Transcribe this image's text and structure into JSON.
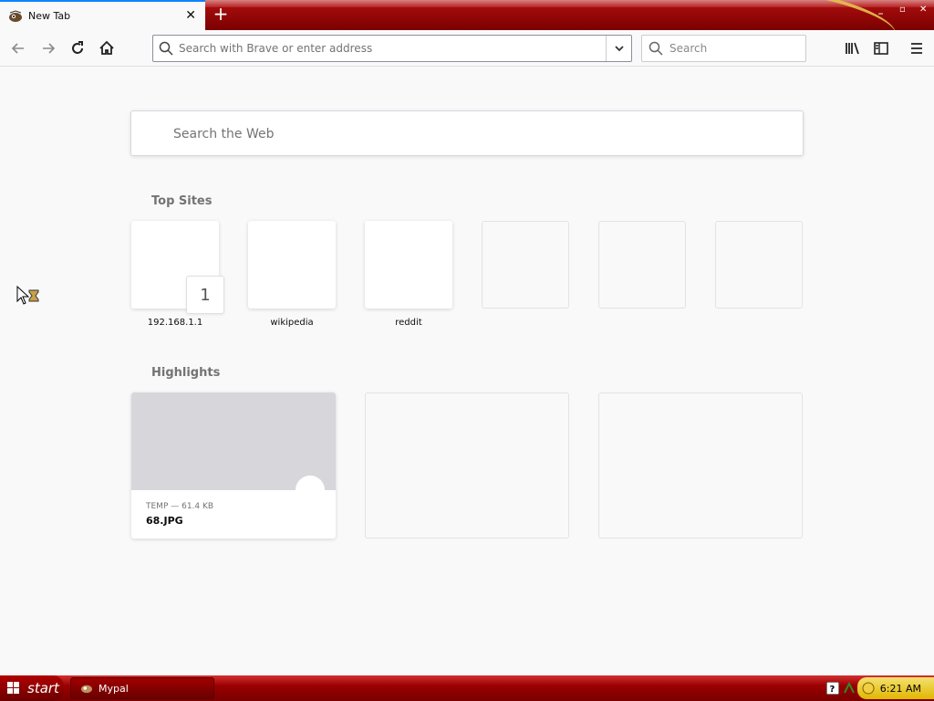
{
  "tab": {
    "title": "New Tab",
    "close_glyph": "✕"
  },
  "newtab_glyph": "+",
  "window_controls": {
    "minimize": "_",
    "restore": "▫",
    "close": "✕"
  },
  "urlbar": {
    "placeholder": "Search with Brave or enter address"
  },
  "searchbar": {
    "placeholder": "Search"
  },
  "web_search": {
    "placeholder": "Search the Web"
  },
  "top_sites": {
    "title": "Top Sites",
    "sites": [
      {
        "label": "192.168.1.1",
        "badge": "1"
      },
      {
        "label": "wikipedia"
      },
      {
        "label": "reddit"
      }
    ]
  },
  "highlights": {
    "title": "Highlights",
    "cards": [
      {
        "meta": "TEMP — 61.4 KB",
        "name": "68.JPG"
      }
    ]
  },
  "taskbar": {
    "start_label": "start",
    "task_label": "Mypal",
    "clock": "6:21 AM"
  },
  "icons": [
    "back-icon",
    "forward-icon",
    "reload-icon",
    "home-icon",
    "search-icon",
    "chevron-down-icon",
    "library-icon",
    "sidebar-icon",
    "menu-icon",
    "windows-logo-icon",
    "help-icon"
  ]
}
